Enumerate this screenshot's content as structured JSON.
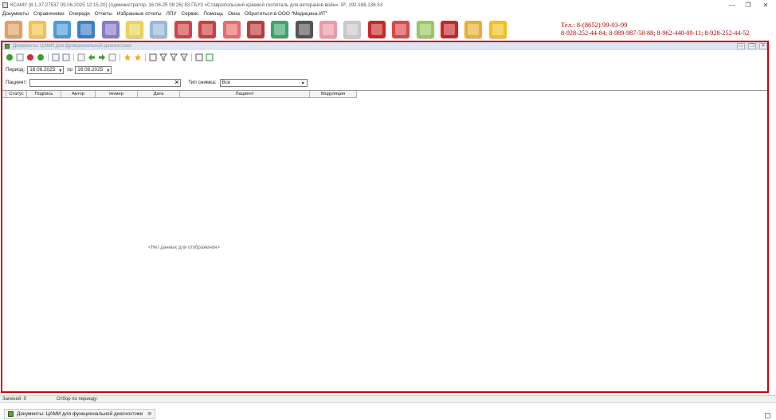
{
  "window": {
    "title": "КСАМУ (8.1.37.27537 09.06.2025 12:15:20) (Администратор, 16.06.25 08:26) 83 ГБУЗ «Ставропольский краевой госпиталь для ветеранов войн». IP: 192.168.136.53",
    "min_glyph": "—",
    "max_glyph": "❐",
    "close_glyph": "✕"
  },
  "menu": {
    "items": [
      "Документы",
      "Справочники",
      "Очереди",
      "Отчеты",
      "Избранные отчеты",
      "ЛПУ",
      "Сервис",
      "Помощь",
      "Окна",
      "Обратиться в ООО \"Медицина-ИТ\""
    ]
  },
  "big_toolbar": {
    "icons": [
      {
        "name": "patient-icon",
        "color": "#e0a060"
      },
      {
        "name": "records-icon",
        "color": "#f2c24a"
      },
      {
        "name": "cards-icon",
        "color": "#4a9bd6"
      },
      {
        "name": "staff-icon",
        "color": "#3b7fc4"
      },
      {
        "name": "lab-icon",
        "color": "#8a7ac8"
      },
      {
        "name": "notes-icon",
        "color": "#e8d35a"
      },
      {
        "name": "syringe-icon",
        "color": "#9ab8d8"
      },
      {
        "name": "scan-icon",
        "color": "#d0434a"
      },
      {
        "name": "medical-kit-icon",
        "color": "#c84040"
      },
      {
        "name": "pills-icon",
        "color": "#e86a6a"
      },
      {
        "name": "books-icon",
        "color": "#b83b3b"
      },
      {
        "name": "globe-icon",
        "color": "#3ea36b"
      },
      {
        "name": "barcode-scanner-icon",
        "color": "#555555"
      },
      {
        "name": "nurse-icon",
        "color": "#e99aa8"
      },
      {
        "name": "thermometer-icon",
        "color": "#c8c8c8"
      },
      {
        "name": "red-book-icon",
        "color": "#c82828"
      },
      {
        "name": "calendar-icon",
        "color": "#d84848"
      },
      {
        "name": "schedule-icon",
        "color": "#9ac860"
      },
      {
        "name": "pdf-icon",
        "color": "#c62828"
      },
      {
        "name": "lock-icon",
        "color": "#e8b030"
      },
      {
        "name": "chat-icon",
        "color": "#f0c020"
      }
    ]
  },
  "contacts": {
    "phone_main": "Тел.: 8-(8652) 99-03-99",
    "phones_other": "8-928-252-44-84; 8-989-987-58-88; 8-962-440-09-11; 8-928-252-44-52"
  },
  "document": {
    "title": "Документы: ЦАМИ для функциональной диагностики",
    "controls": [
      "▭",
      "❐",
      "✕"
    ],
    "toolbar_icons": [
      {
        "name": "add-icon",
        "color": "#3a9d2c",
        "shape": "circle"
      },
      {
        "name": "edit-icon",
        "color": "#7a8aa0",
        "shape": "square"
      },
      {
        "name": "delete-icon",
        "color": "#d62b2b",
        "shape": "circle"
      },
      {
        "name": "refresh-icon",
        "color": "#3a9d2c",
        "shape": "circle"
      },
      {
        "name": "sep",
        "color": "",
        "shape": "sep"
      },
      {
        "name": "export-icon",
        "color": "#6a7d9a",
        "shape": "square"
      },
      {
        "name": "import-icon",
        "color": "#6a7d9a",
        "shape": "square"
      },
      {
        "name": "sep",
        "color": "",
        "shape": "sep"
      },
      {
        "name": "details-icon",
        "color": "#8c8c8c",
        "shape": "square"
      },
      {
        "name": "arrow-left-icon",
        "color": "#3a9d2c",
        "shape": "arrow"
      },
      {
        "name": "arrow-right-icon",
        "color": "#3a9d2c",
        "shape": "arrow"
      },
      {
        "name": "document-icon",
        "color": "#8c8c8c",
        "shape": "square"
      },
      {
        "name": "sep",
        "color": "",
        "shape": "sep"
      },
      {
        "name": "star-add-icon",
        "color": "#e3b21c",
        "shape": "star"
      },
      {
        "name": "star-remove-icon",
        "color": "#e3b21c",
        "shape": "star"
      },
      {
        "name": "sep",
        "color": "",
        "shape": "sep"
      },
      {
        "name": "settings-icon",
        "color": "#555",
        "shape": "square"
      },
      {
        "name": "filter-icon",
        "color": "#555",
        "shape": "funnel"
      },
      {
        "name": "filter-edit-icon",
        "color": "#555",
        "shape": "funnel"
      },
      {
        "name": "filter-clear-icon",
        "color": "#555",
        "shape": "funnel"
      },
      {
        "name": "sep",
        "color": "",
        "shape": "sep"
      },
      {
        "name": "print-icon",
        "color": "#555",
        "shape": "square"
      },
      {
        "name": "excel-icon",
        "color": "#2f8f3a",
        "shape": "square"
      }
    ],
    "period_label": "Период:",
    "period_from": "16.06.2025",
    "period_to_label": "по",
    "period_to": "16.06.2025",
    "patient_label": "Пациент:",
    "patient_value": "",
    "clear_glyph": "✕",
    "scan_type_label": "Тип снимка:",
    "scan_type_value": "Все",
    "dropdown_glyph": "▼",
    "columns": [
      "",
      "Статус",
      "Подпись",
      "Автор",
      "Номер",
      "Дата",
      "Пациент",
      "Модуляция"
    ],
    "empty_message": "<Нет данных для отображения>"
  },
  "status": {
    "records": "Записей: 0",
    "filter_info": "Отбор по периоду:"
  },
  "taskbar": {
    "tab_label": "Документы: ЦАМИ для функциональной диагностики",
    "tab_close": "⊠"
  }
}
